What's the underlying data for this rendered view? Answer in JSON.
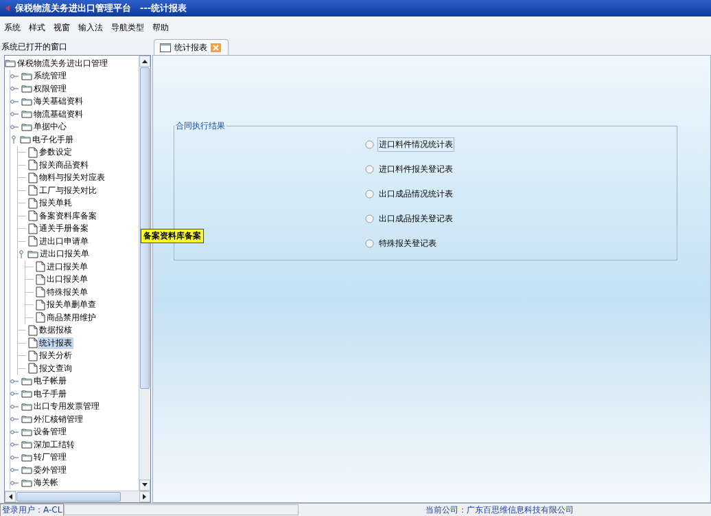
{
  "window": {
    "title": "保税物流关务进出口管理平台　---统计报表"
  },
  "menu": [
    "系统",
    "样式",
    "视窗",
    "输入法",
    "导航类型",
    "帮助"
  ],
  "sidebar": {
    "title": "系统已打开的窗口",
    "tree": [
      {
        "label": "保税物流关务进出口管理",
        "kind": "folder",
        "selected": false,
        "children": [
          {
            "label": "系统管理",
            "kind": "folder",
            "expanded": false,
            "selected": false
          },
          {
            "label": "权限管理",
            "kind": "folder",
            "expanded": false,
            "selected": false
          },
          {
            "label": "海关基础资料",
            "kind": "folder",
            "expanded": false,
            "selected": false
          },
          {
            "label": "物流基础资料",
            "kind": "folder",
            "expanded": false,
            "selected": false
          },
          {
            "label": "单据中心",
            "kind": "folder",
            "expanded": false,
            "selected": false
          },
          {
            "label": "电子化手册",
            "kind": "folder",
            "expanded": true,
            "selected": false,
            "children": [
              {
                "label": "参数设定",
                "kind": "doc",
                "selected": false
              },
              {
                "label": "报关商品资料",
                "kind": "doc",
                "selected": false
              },
              {
                "label": "物料与报关对应表",
                "kind": "doc",
                "selected": false
              },
              {
                "label": "工厂与报关对比",
                "kind": "doc",
                "selected": false
              },
              {
                "label": "报关单耗",
                "kind": "doc",
                "selected": false
              },
              {
                "label": "备案资料库备案",
                "kind": "doc",
                "selected": false
              },
              {
                "label": "通关手册备案",
                "kind": "doc",
                "selected": false
              },
              {
                "label": "进出口申请单",
                "kind": "doc",
                "selected": false
              },
              {
                "label": "进出口报关单",
                "kind": "folder",
                "expanded": true,
                "selected": false,
                "children": [
                  {
                    "label": "进口报关单",
                    "kind": "doc",
                    "selected": false
                  },
                  {
                    "label": "出口报关单",
                    "kind": "doc",
                    "selected": false
                  },
                  {
                    "label": "特殊报关单",
                    "kind": "doc",
                    "selected": false
                  },
                  {
                    "label": "报关单删单查",
                    "kind": "doc",
                    "selected": false
                  },
                  {
                    "label": "商品禁用维护",
                    "kind": "doc",
                    "selected": false
                  }
                ]
              },
              {
                "label": "数据报核",
                "kind": "doc",
                "selected": false
              },
              {
                "label": "统计报表",
                "kind": "doc",
                "selected": true
              },
              {
                "label": "报关分析",
                "kind": "doc",
                "selected": false
              },
              {
                "label": "报文查询",
                "kind": "doc",
                "selected": false
              }
            ]
          },
          {
            "label": "电子帐册",
            "kind": "folder",
            "expanded": false,
            "selected": false
          },
          {
            "label": "电子手册",
            "kind": "folder",
            "expanded": false,
            "selected": false
          },
          {
            "label": "出口专用发票管理",
            "kind": "folder",
            "expanded": false,
            "selected": false
          },
          {
            "label": "外汇核销管理",
            "kind": "folder",
            "expanded": false,
            "selected": false
          },
          {
            "label": "设备管理",
            "kind": "folder",
            "expanded": false,
            "selected": false
          },
          {
            "label": "深加工结转",
            "kind": "folder",
            "expanded": false,
            "selected": false
          },
          {
            "label": "转厂管理",
            "kind": "folder",
            "expanded": false,
            "selected": false
          },
          {
            "label": "委外管理",
            "kind": "folder",
            "expanded": false,
            "selected": false
          },
          {
            "label": "海关帐",
            "kind": "folder",
            "expanded": false,
            "selected": false
          }
        ]
      }
    ]
  },
  "tooltip": "备案资料库备案",
  "tabs": [
    {
      "label": "统计报表",
      "selected": true
    }
  ],
  "group": {
    "title": "合同执行结果",
    "options": [
      {
        "label": "进口料件情况统计表",
        "selected": false,
        "focused": true
      },
      {
        "label": "进口料件报关登记表",
        "selected": false,
        "focused": false
      },
      {
        "label": "出口成品情况统计表",
        "selected": false,
        "focused": false
      },
      {
        "label": "出口成品报关登记表",
        "selected": false,
        "focused": false
      },
      {
        "label": "特殊报关登记表",
        "selected": false,
        "focused": false
      }
    ]
  },
  "status_bar": {
    "user": "登录用户：A-CL",
    "company": "当前公司：广东百思维信息科技有限公司"
  }
}
